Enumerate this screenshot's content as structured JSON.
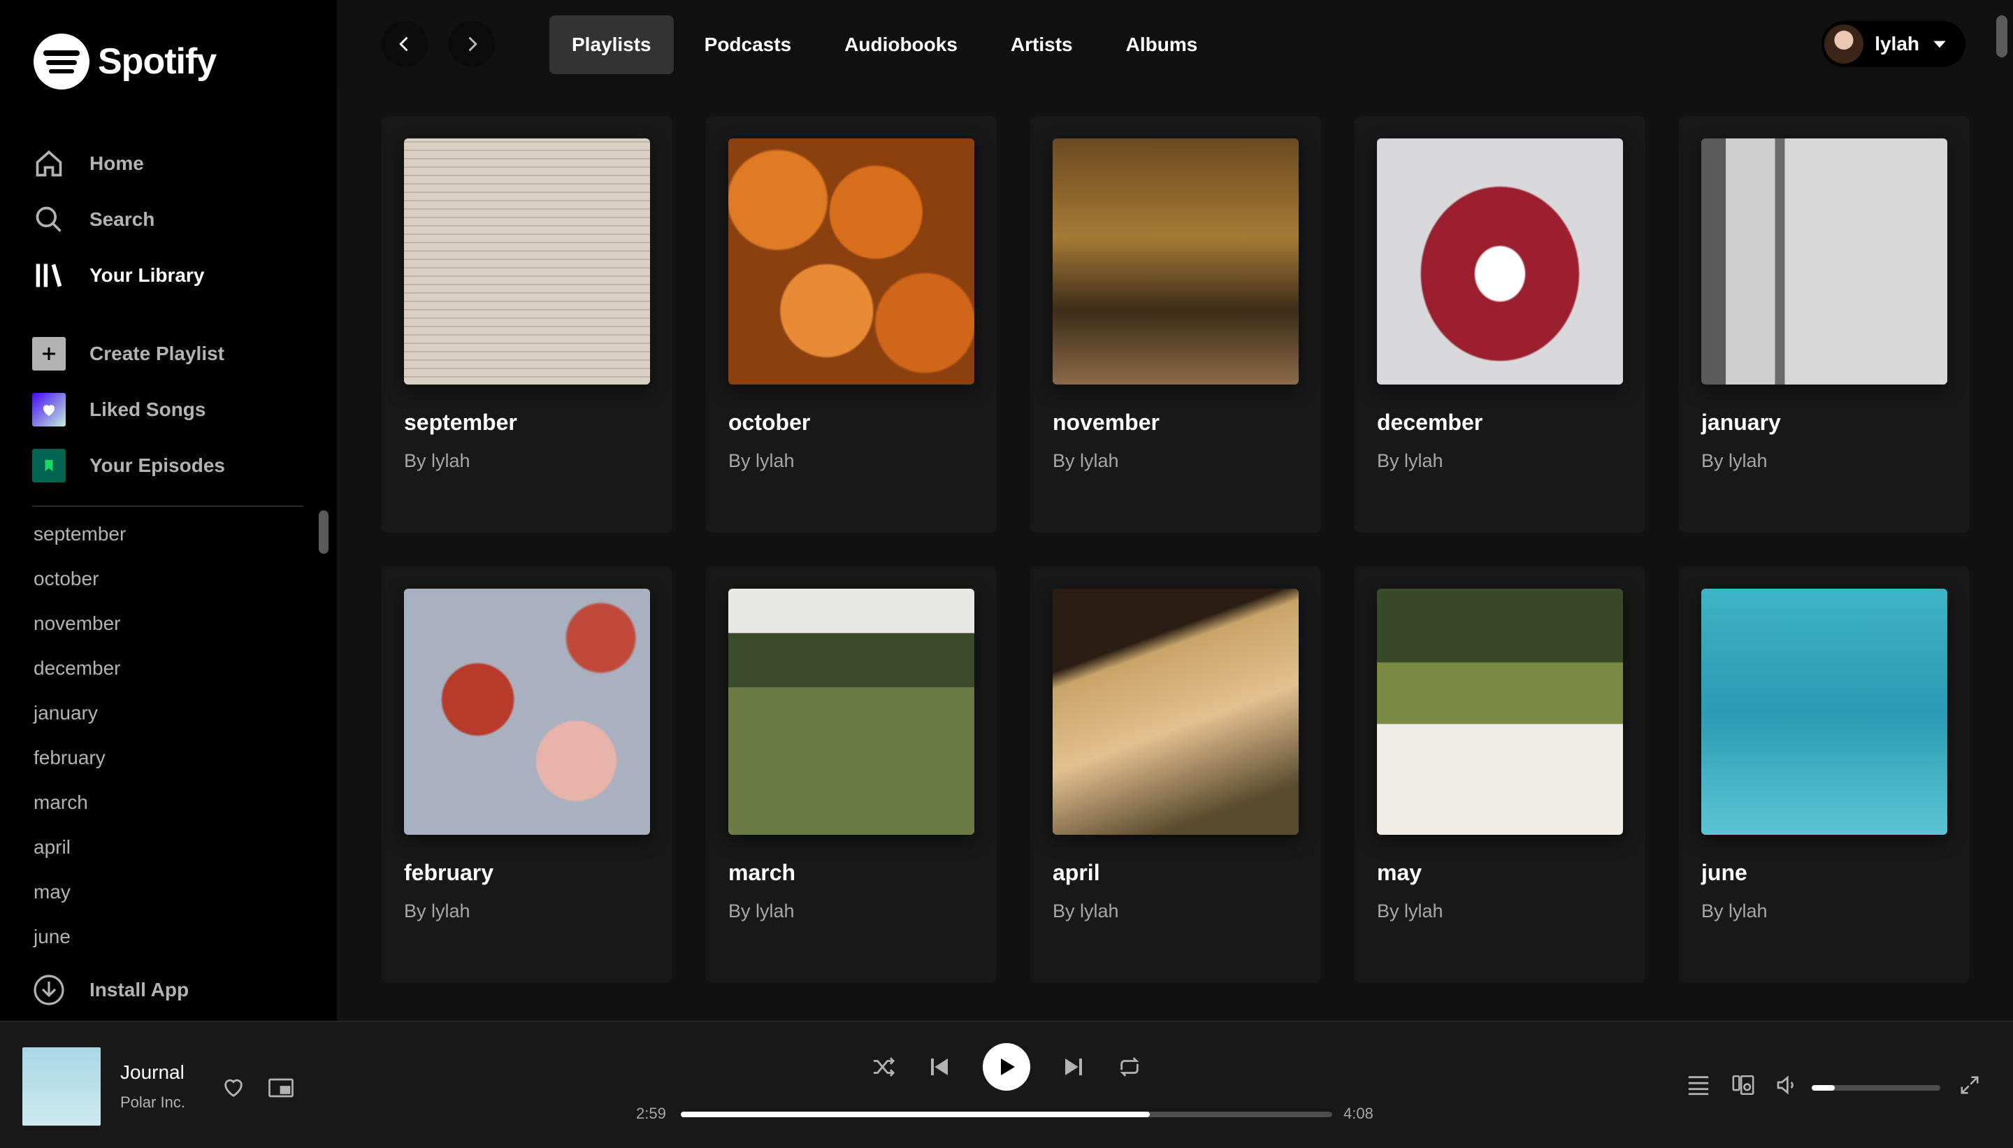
{
  "brand": {
    "name": "Spotify"
  },
  "sidebar": {
    "nav": [
      {
        "label": "Home",
        "icon": "home-icon"
      },
      {
        "label": "Search",
        "icon": "search-icon"
      },
      {
        "label": "Your Library",
        "icon": "library-icon"
      }
    ],
    "actions": [
      {
        "label": "Create Playlist",
        "icon": "plus-icon",
        "color": "#b3b3b3"
      },
      {
        "label": "Liked Songs",
        "icon": "heart-icon",
        "color": "#6c43e0"
      },
      {
        "label": "Your Episodes",
        "icon": "bookmark-icon",
        "color": "#006450"
      }
    ],
    "playlists": [
      "september",
      "october",
      "november",
      "december",
      "january",
      "february",
      "march",
      "april",
      "may",
      "june"
    ],
    "install": "Install App"
  },
  "topbar": {
    "tabs": [
      "Playlists",
      "Podcasts",
      "Audiobooks",
      "Artists",
      "Albums"
    ],
    "active_tab": "Playlists",
    "user": "lylah"
  },
  "cards": [
    {
      "title": "september",
      "subtitle": "By lylah"
    },
    {
      "title": "october",
      "subtitle": "By lylah"
    },
    {
      "title": "november",
      "subtitle": "By lylah"
    },
    {
      "title": "december",
      "subtitle": "By lylah"
    },
    {
      "title": "january",
      "subtitle": "By lylah"
    },
    {
      "title": "february",
      "subtitle": "By lylah"
    },
    {
      "title": "march",
      "subtitle": "By lylah"
    },
    {
      "title": "april",
      "subtitle": "By lylah"
    },
    {
      "title": "may",
      "subtitle": "By lylah"
    },
    {
      "title": "june",
      "subtitle": "By lylah"
    }
  ],
  "player": {
    "title": "Journal",
    "artist": "Polar Inc.",
    "elapsed": "2:59",
    "duration": "4:08",
    "progress": 0.72,
    "volume": 0.18
  },
  "colors": {
    "accent": "#1ed760",
    "background": "#121212"
  }
}
